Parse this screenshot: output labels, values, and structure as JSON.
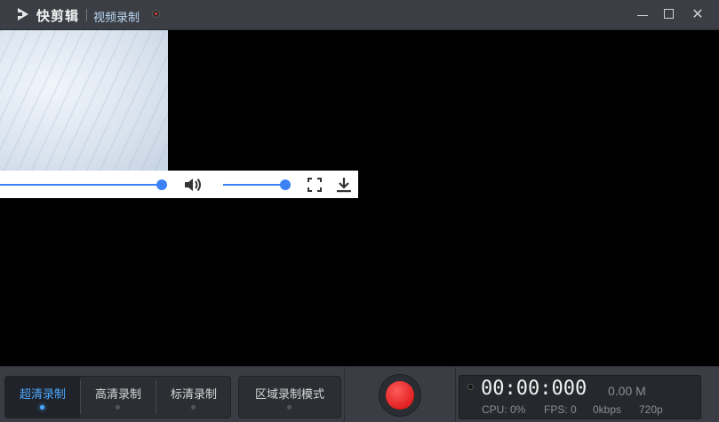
{
  "titlebar": {
    "app_name": "快剪辑",
    "mode": "视频录制"
  },
  "window_controls": {
    "minimize_icon": "minimize-icon",
    "maximize_icon": "maximize-icon",
    "close": "✕"
  },
  "player": {
    "seek_progress": 1.0,
    "volume_level": 1.0,
    "icons": [
      "volume-icon",
      "fullscreen-icon",
      "download-icon"
    ]
  },
  "quality_buttons": [
    {
      "label": "超清录制",
      "active": true
    },
    {
      "label": "高清录制",
      "active": false
    },
    {
      "label": "标清录制",
      "active": false
    }
  ],
  "region_button": {
    "label": "区域录制模式"
  },
  "stats": {
    "timer": "00:00:000",
    "size": "0.00 M",
    "cpu": "CPU: 0%",
    "fps": "FPS: 0",
    "bitrate": "0kbps",
    "resolution": "720p"
  },
  "colors": {
    "accent": "#4aa8ff",
    "record": "#e02020",
    "slider": "#3b82f6"
  }
}
